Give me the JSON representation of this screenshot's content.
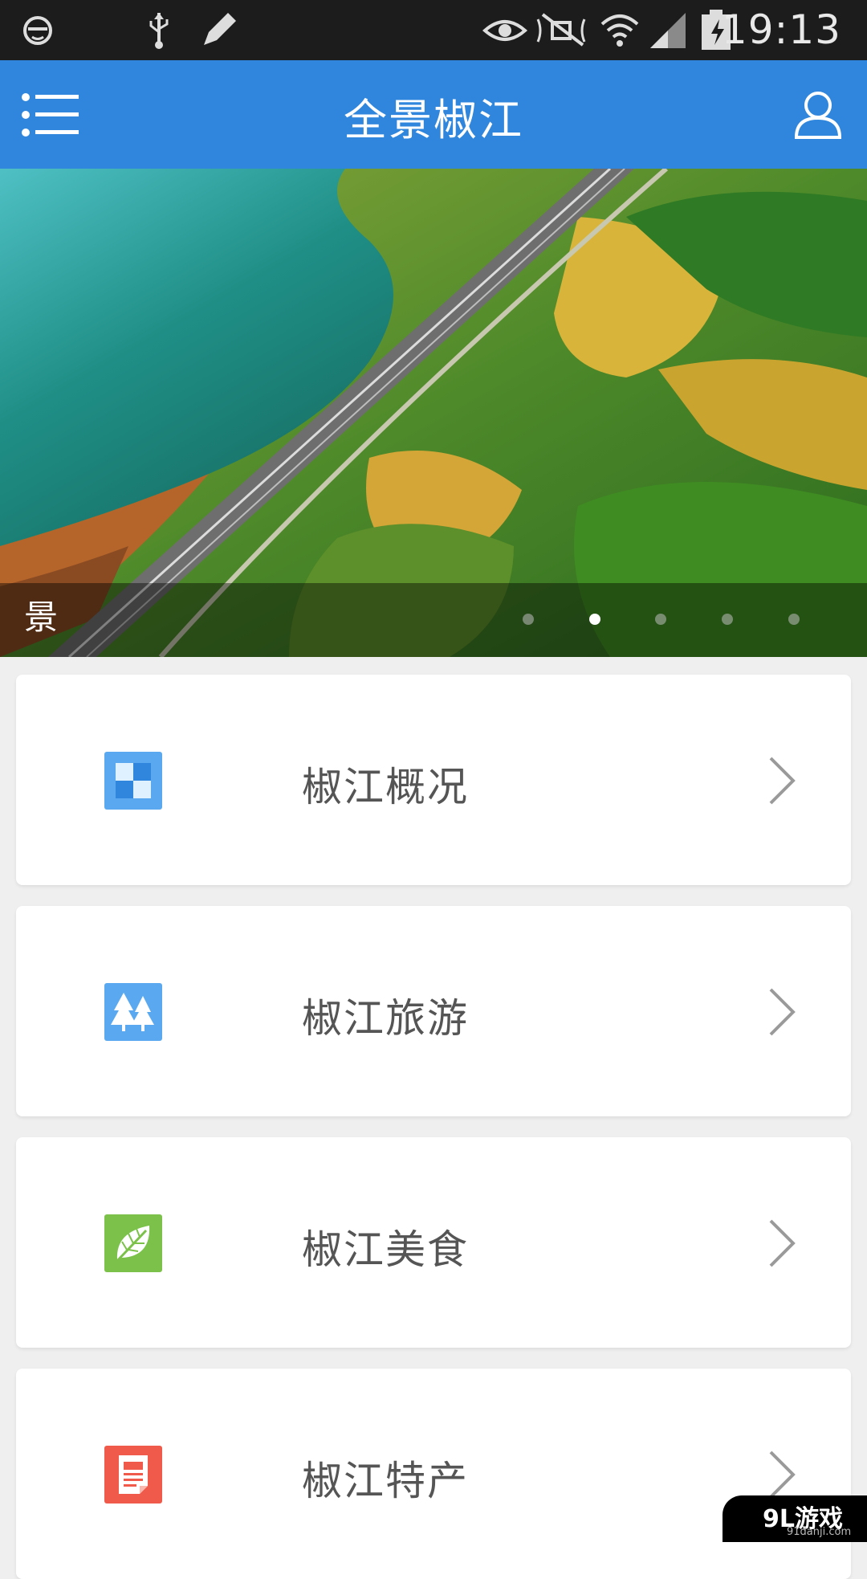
{
  "status_bar": {
    "time": "19:13",
    "icons": [
      "face-icon",
      "usb-icon",
      "pencil-icon",
      "eye-icon",
      "mute-icon",
      "wifi-icon",
      "signal-icon",
      "battery-icon"
    ]
  },
  "app_bar": {
    "title": "全景椒江",
    "menu_icon": "menu-icon",
    "user_icon": "user-icon",
    "color": "#2f86dc"
  },
  "banner": {
    "caption": "景",
    "page_count": 5,
    "active_index": 1
  },
  "menu": {
    "items": [
      {
        "label": "椒江概况",
        "icon": "overview-icon",
        "icon_color": "#5aa9f0"
      },
      {
        "label": "椒江旅游",
        "icon": "trees-icon",
        "icon_color": "#5aa9f0"
      },
      {
        "label": "椒江美食",
        "icon": "leaf-icon",
        "icon_color": "#7cc24a"
      },
      {
        "label": "椒江特产",
        "icon": "document-icon",
        "icon_color": "#f05a4a"
      }
    ]
  },
  "watermark": {
    "main": "9L游戏",
    "sub": "91danji.com"
  }
}
